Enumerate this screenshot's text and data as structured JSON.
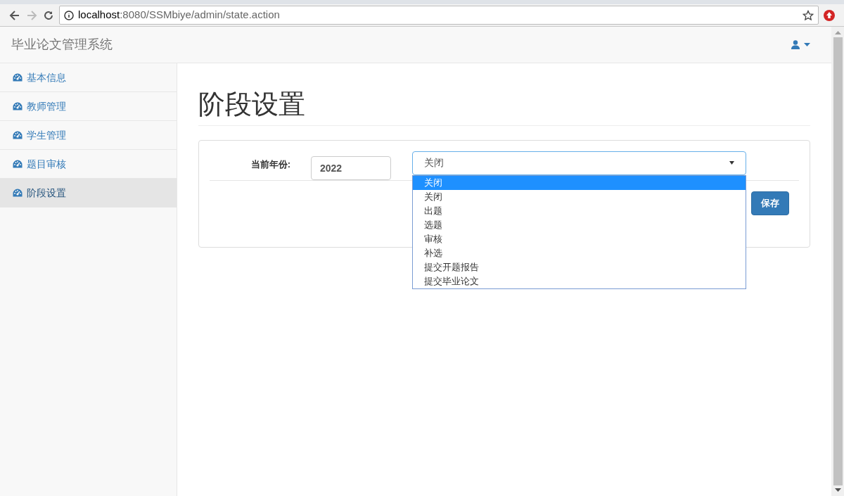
{
  "browser": {
    "url_host": "localhost",
    "url_path": ":8080/SSMbiye/admin/state.action"
  },
  "navbar": {
    "brand": "毕业论文管理系统"
  },
  "sidebar": {
    "items": [
      {
        "label": "基本信息",
        "selected": false
      },
      {
        "label": "教师管理",
        "selected": false
      },
      {
        "label": "学生管理",
        "selected": false
      },
      {
        "label": "题目审核",
        "selected": false
      },
      {
        "label": "阶段设置",
        "selected": true
      }
    ]
  },
  "page": {
    "heading": "阶段设置",
    "year_label": "当前年份:",
    "year_value": "2022",
    "stage_value": "关闭",
    "stage_options": [
      {
        "label": "关闭",
        "selected": true
      },
      {
        "label": "关闭",
        "selected": false
      },
      {
        "label": "出题",
        "selected": false
      },
      {
        "label": "选题",
        "selected": false
      },
      {
        "label": "审核",
        "selected": false
      },
      {
        "label": "补选",
        "selected": false
      },
      {
        "label": "提交开题报告",
        "selected": false
      },
      {
        "label": "提交毕业论文",
        "selected": false
      }
    ],
    "save_button": "保存"
  }
}
